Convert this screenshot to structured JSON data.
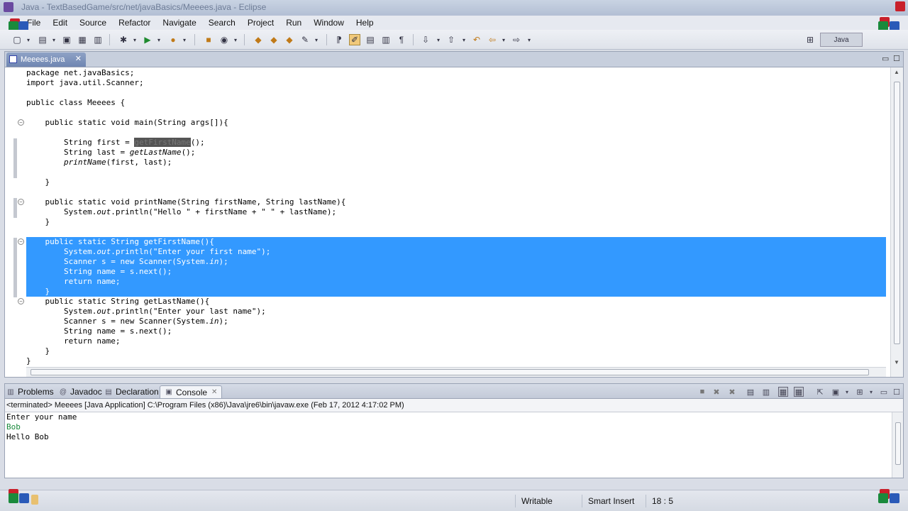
{
  "window": {
    "title": "Java - TextBasedGame/src/net/javaBasics/Meeees.java - Eclipse"
  },
  "menu": {
    "items": [
      "File",
      "Edit",
      "Source",
      "Refactor",
      "Navigate",
      "Search",
      "Project",
      "Run",
      "Window",
      "Help"
    ]
  },
  "toolbar": {
    "perspective_label": "Java"
  },
  "editor": {
    "tab_label": "Meeees.java",
    "lines": [
      {
        "text": "package net.javaBasics;"
      },
      {
        "text": "import java.util.Scanner;"
      },
      {
        "text": ""
      },
      {
        "text": "public class Meeees {"
      },
      {
        "text": ""
      },
      {
        "text": "    public static void main(String args[]){"
      },
      {
        "text": ""
      },
      {
        "pre": "        String first = ",
        "occ": "getFirstName",
        "post": "();"
      },
      {
        "pre": "        String last = ",
        "ital": "getLastName",
        "post": "();"
      },
      {
        "ital": "        printName",
        "post": "(first, last);"
      },
      {
        "text": ""
      },
      {
        "text": "    }"
      },
      {
        "text": ""
      },
      {
        "text": "    public static void printName(String firstName, String lastName){"
      },
      {
        "pre": "        System.",
        "ital": "out",
        "post": ".println(\"Hello \" + firstName + \" \" + lastName);"
      },
      {
        "text": "    }"
      },
      {
        "text": ""
      },
      {
        "text": "    public static String getFirstName(){",
        "selected": true
      },
      {
        "pre": "        System.",
        "ital": "out",
        "post": ".println(\"Enter your first name\");",
        "selected": true
      },
      {
        "pre": "        Scanner s = new Scanner(System.",
        "ital": "in",
        "post": ");",
        "selected": true
      },
      {
        "text": "        String name = s.next();",
        "selected": true
      },
      {
        "text": "        return name;",
        "selected": true
      },
      {
        "text": "    }",
        "selected": true
      },
      {
        "text": "    public static String getLastName(){"
      },
      {
        "pre": "        System.",
        "ital": "out",
        "post": ".println(\"Enter your last name\");"
      },
      {
        "pre": "        Scanner s = new Scanner(System.",
        "ital": "in",
        "post": ");"
      },
      {
        "text": "        String name = s.next();"
      },
      {
        "text": "        return name;"
      },
      {
        "text": "    }"
      },
      {
        "text": "}"
      }
    ],
    "fold_lines": [
      5,
      13,
      17,
      23
    ]
  },
  "panel": {
    "tabs": [
      {
        "label": "Problems",
        "icon": "problems-icon"
      },
      {
        "label": "Javadoc",
        "icon": "at-icon"
      },
      {
        "label": "Declaration",
        "icon": "declaration-icon"
      },
      {
        "label": "Console",
        "icon": "console-icon",
        "active": true
      }
    ]
  },
  "console": {
    "header": "<terminated> Meeees [Java Application] C:\\Program Files (x86)\\Java\\jre6\\bin\\javaw.exe (Feb 17, 2012 4:17:02 PM)",
    "lines": [
      {
        "text": "Enter your name",
        "type": "output"
      },
      {
        "text": "Bob",
        "type": "input"
      },
      {
        "text": "Hello Bob",
        "type": "output"
      }
    ]
  },
  "status": {
    "writable": "Writable",
    "insert_mode": "Smart Insert",
    "position": "18 : 5"
  },
  "colors": {
    "selection": "#3399ff",
    "console_input": "#1a8a3c"
  }
}
